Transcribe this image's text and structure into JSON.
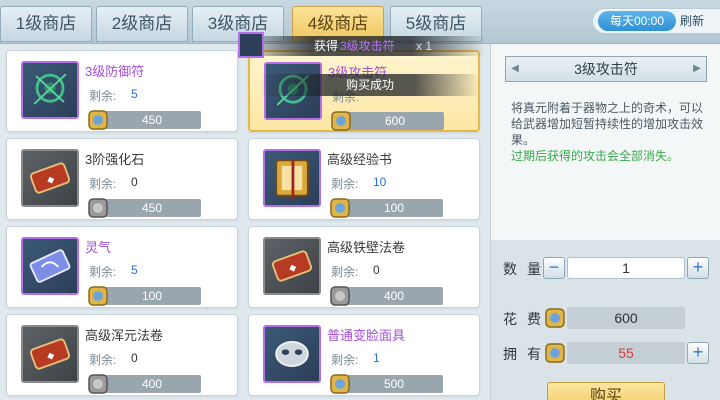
{
  "tabs": [
    {
      "label": "1级商店"
    },
    {
      "label": "2级商店"
    },
    {
      "label": "3级商店"
    },
    {
      "label": "4级商店",
      "active": true
    },
    {
      "label": "5级商店"
    }
  ],
  "refresh": {
    "time_label": "每天00:00",
    "button_label": "刷新"
  },
  "items": [
    {
      "name": "3级防御符",
      "remain_label": "剩余:",
      "remain": "5",
      "price": "450"
    },
    {
      "name": "3级攻击符",
      "remain_label": "剩余:",
      "remain": "",
      "price": "600"
    },
    {
      "name": "3阶强化石",
      "remain_label": "剩余:",
      "remain": "0",
      "price": "450"
    },
    {
      "name": "高级经验书",
      "remain_label": "剩余:",
      "remain": "10",
      "price": "100"
    },
    {
      "name": "灵气",
      "remain_label": "剩余:",
      "remain": "5",
      "price": "100"
    },
    {
      "name": "高级铁壁法卷",
      "remain_label": "剩余:",
      "remain": "0",
      "price": "400"
    },
    {
      "name": "高级浑元法卷",
      "remain_label": "剩余:",
      "remain": "0",
      "price": "400"
    },
    {
      "name": "普通变脸面具",
      "remain_label": "剩余:",
      "remain": "1",
      "price": "500"
    }
  ],
  "toast": {
    "prefix": "获得",
    "item": "3级攻击符",
    "count": "x 1",
    "message": "购买成功"
  },
  "detail": {
    "title": "3级攻击符",
    "description": "将真元附着于器物之上的奇术，可以给武器增加短暂持续性的增加攻击效果。",
    "warning": "过期后获得的攻击会全部消失。",
    "quantity_label": "数量",
    "quantity": "1",
    "cost_label": "花费",
    "cost": "600",
    "own_label": "拥有",
    "own": "55",
    "buy_label": "购买"
  },
  "colors": {
    "accent_gold": "#f0c65e",
    "purple_rarity": "#a24fd8",
    "blue_value": "#2c6ed4",
    "warn_green": "#37a948",
    "own_red": "#e23a3a"
  }
}
